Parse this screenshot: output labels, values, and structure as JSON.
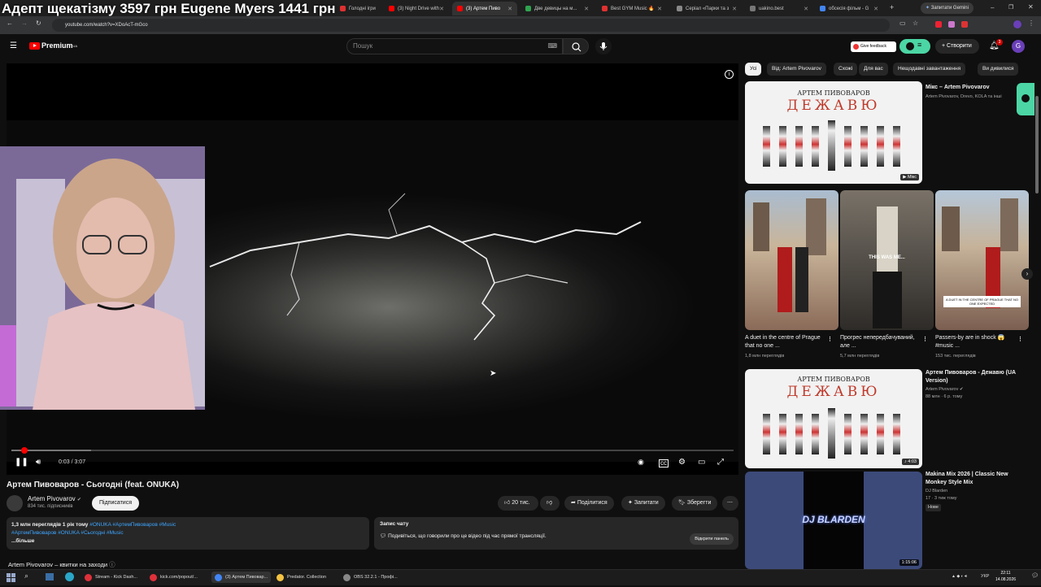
{
  "overlay_title": "Адепт щекатізму 3597 грн  Eugene Myers  1441 грн",
  "browser": {
    "tabs": [
      {
        "label": "Голодні ігри",
        "color": "#e03030"
      },
      {
        "label": "(3) Night Drive with",
        "color": "#ff0000"
      },
      {
        "label": "(3) Артем Пиво",
        "color": "#ff0000"
      },
      {
        "label": "Две девицы на м...",
        "color": "#2ea44f"
      },
      {
        "label": "Best GYM Music 🔥",
        "color": "#e03030"
      },
      {
        "label": "Серіал «Парки та з",
        "color": "#888888"
      },
      {
        "label": "uakino.best",
        "color": "#777777"
      },
      {
        "label": "обсесія фільм - G",
        "color": "#4285f4"
      }
    ],
    "gemini_label": "Запитати Gemini",
    "url": "youtube.com/watch?v=XDoAcT-mGco"
  },
  "youtube": {
    "logo": "Premium",
    "logo_sup": "UA",
    "search_placeholder": "Пошук",
    "feedback": "Give feedback",
    "create": "Створити",
    "notifications": "3",
    "avatar": "G"
  },
  "player": {
    "time": "0:03 / 3:07",
    "progress": 0.016
  },
  "video": {
    "title": "Артем Пивоваров - Сьогодні (feat. ONUKA)",
    "channel": "Artem Pivovarov",
    "subs": "834 тис. підписників",
    "subscribe": "Підписатися",
    "likes": "20 тис.",
    "share": "Поділитися",
    "ask": "Запитати",
    "save": "Зберегти",
    "desc_stats": "1,3 млн переглядів  1 рік тому",
    "desc_tags_1": "#ONUKA #АртемПивоваров #Music",
    "desc_tags_2": "#АртемПивоваров #ONUKA #Сьогодні #Music",
    "desc_more": "...більше",
    "chat_title": "Запис чату",
    "chat_text": "Подивіться, що говорили про це відео під час прямої трансляції.",
    "chat_button": "Відкрити панель",
    "tickets": "Artem Pivovarov – квитки на заходи"
  },
  "chips": [
    "Усі",
    "Від: Artem Pivovarov",
    "Схожі",
    "Для вас",
    "Нещодавні завантаження",
    "Ви дивилися"
  ],
  "recs": {
    "mix": {
      "title": "Мікс – Artem Pivovarov",
      "meta": "Artem Pivovarov, Drevo, KOLA та інші",
      "badge": "Мікс",
      "thumb_text": "ДЕЖАВЮ",
      "thumb_head": "АРТЕМ ПИВОВАРОВ"
    },
    "shorts": [
      {
        "title": "A duet in the centre of Prague that no one ...",
        "views": "1,8 млн переглядів"
      },
      {
        "title": "Прогрес непередбачуваний, але ...",
        "views": "5,7 млн переглядів",
        "overlay": "THIS WAS ME..."
      },
      {
        "title": "Passers-by are in shock 😱 #music ...",
        "views": "153 тис. переглядів",
        "overlay": "A DUET IN THE CENTRE OF PRAGUE THAT NO ONE EXPECTED"
      }
    ],
    "v1": {
      "title": "Артем Пивоваров - Дежавю (UA Version)",
      "channel": "Artem Pivovarov",
      "meta": "88 млн · 6 р. тому",
      "dur": "4:03"
    },
    "v2": {
      "title": "Makina Mix 2026 | Classic New Monkey Style Mix",
      "channel": "DJ Blarden",
      "meta": "17 · 3 тиж тому",
      "badge": "Нове",
      "dur": "1:15:06",
      "thumb_text": "DJ BLARDEN"
    }
  },
  "taskbar": {
    "items": [
      {
        "label": "Stream - Kick Dash...",
        "color": "#e0303a"
      },
      {
        "label": "kick.com/popout/...",
        "color": "#e0303a"
      },
      {
        "label": "(3) Артем Пивовар...",
        "color": "#4285f4"
      },
      {
        "label": "Predator. Collection",
        "color": "#f5c342"
      },
      {
        "label": "OBS 32.2.1 - Профі...",
        "color": "#888888"
      }
    ],
    "lang": "УКР",
    "time": "22:11",
    "date": "14.08.2026"
  }
}
